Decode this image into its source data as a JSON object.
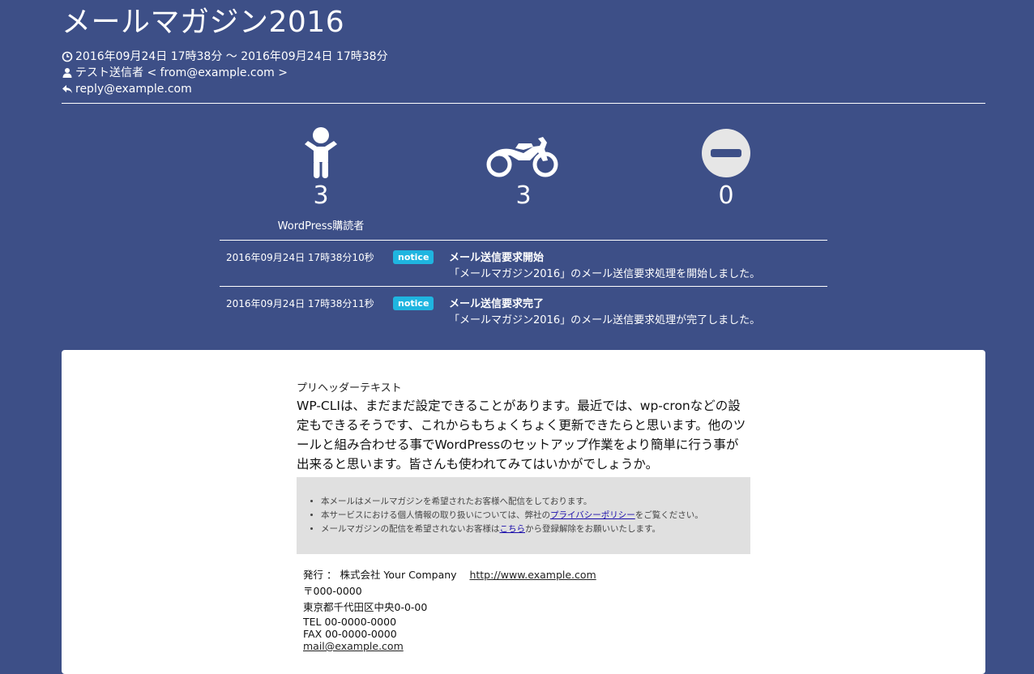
{
  "header": {
    "title": "メールマガジン2016",
    "period": "2016年09月24日 17時38分 〜 2016年09月24日 17時38分",
    "sender": "テスト送信者 < from@example.com >",
    "reply_to": "reply@example.com"
  },
  "stats": [
    {
      "icon": "child-icon",
      "value": "3",
      "label": "WordPress購読者"
    },
    {
      "icon": "motorcycle-icon",
      "value": "3",
      "label": ""
    },
    {
      "icon": "no-entry-icon",
      "value": "0",
      "label": ""
    }
  ],
  "log": [
    {
      "timestamp": "2016年09月24日 17時38分10秒",
      "level": "notice",
      "heading": "メール送信要求開始",
      "detail": "「メールマガジン2016」のメール送信要求処理を開始しました。"
    },
    {
      "timestamp": "2016年09月24日 17時38分11秒",
      "level": "notice",
      "heading": "メール送信要求完了",
      "detail": "「メールマガジン2016」のメール送信要求処理が完了しました。"
    }
  ],
  "mail": {
    "preheader": "プリヘッダーテキスト",
    "body": "WP-CLIは、まだまだ設定できることがあります。最近では、wp-cronなどの設定もできるそうです、これからもちょくちょく更新できたらと思います。他のツールと組み合わせる事でWordPressのセットアップ作業をより簡単に行う事が出来ると思います。皆さんも使われてみてはいかがでしょうか。",
    "notes": {
      "line1": "本メールはメールマガジンを希望されたお客様へ配信をしております。",
      "line2_pre": "本サービスにおける個人情報の取り扱いについては、弊社の",
      "line2_link": "プライバシーポリシー",
      "line2_post": "をご覧ください。",
      "line3_pre": "メールマガジンの配信を希望されないお客様は",
      "line3_link": "こちら",
      "line3_post": "から登録解除をお願いいたします。"
    },
    "footer": {
      "publisher": "発行 ： 株式会社 Your Company",
      "url": "http://www.example.com",
      "postal": "〒000-0000",
      "address": "東京都千代田区中央0-0-00",
      "tel": "TEL 00-0000-0000",
      "fax": "FAX 00-0000-0000",
      "email": "mail@example.com"
    }
  },
  "colors": {
    "background": "#3d4f87",
    "badge": "#1fb5e0",
    "panel": "#ffffff",
    "notes_bg": "#e0e0e0"
  }
}
